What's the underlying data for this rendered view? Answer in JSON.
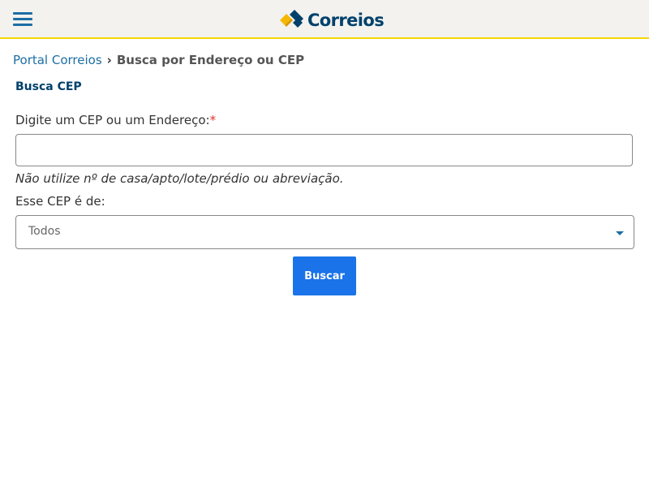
{
  "header": {
    "menu_icon": "hamburger-menu-icon",
    "logo_text": "Correios",
    "logo_icon": "correios-logo-icon",
    "colors": {
      "logo_blue": "#00416b",
      "logo_yellow": "#f5b800",
      "accent_border": "#f5d800"
    }
  },
  "breadcrumb": {
    "home": "Portal Correios",
    "separator": "›",
    "current": "Busca por Endereço ou CEP"
  },
  "page": {
    "title": "Busca CEP"
  },
  "form": {
    "cep_label": "Digite um CEP ou um Endereço:",
    "required_marker": "*",
    "cep_value": "",
    "hint": "Não utilize nº de casa/apto/lote/prédio ou abreviação.",
    "type_label": "Esse CEP é de:",
    "type_selected": "Todos",
    "submit_label": "Buscar"
  },
  "colors": {
    "link": "#1c6ea4",
    "button": "#1a73e8",
    "required": "#e0312a"
  }
}
